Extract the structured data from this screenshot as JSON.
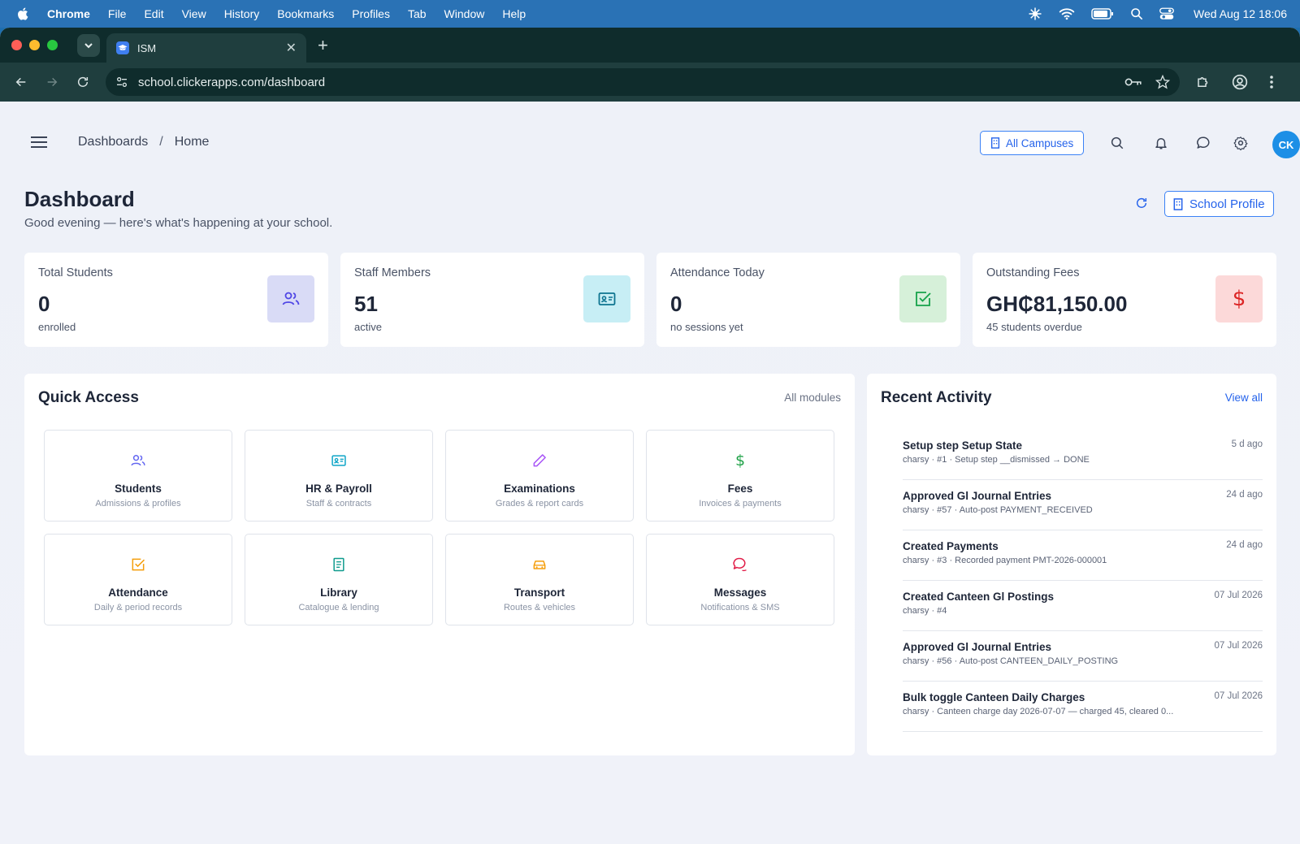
{
  "menubar": {
    "app": "Chrome",
    "items": [
      "File",
      "Edit",
      "View",
      "History",
      "Bookmarks",
      "Profiles",
      "Tab",
      "Window",
      "Help"
    ],
    "clock": "Wed Aug 12  18:06"
  },
  "browser": {
    "tab_title": "ISM",
    "url": "school.clickerapps.com/dashboard"
  },
  "topbar": {
    "breadcrumb": [
      "Dashboards",
      "Home"
    ],
    "campus_button": "All Campuses",
    "avatar_initials": "CK"
  },
  "header": {
    "title": "Dashboard",
    "subtitle": "Good evening — here's what's happening at your school.",
    "profile_button": "School Profile"
  },
  "stats": [
    {
      "label": "Total Students",
      "value": "0",
      "note": "enrolled",
      "icon": "users-icon",
      "color": "#d9dbf6"
    },
    {
      "label": "Staff Members",
      "value": "51",
      "note": "active",
      "icon": "id-card-icon",
      "color": "#c7eef5"
    },
    {
      "label": "Attendance Today",
      "value": "0",
      "note": "no sessions yet",
      "icon": "check-square-icon",
      "color": "#d6f0d9"
    },
    {
      "label": "Outstanding Fees",
      "value": "GH₵81,150.00",
      "note": "45 students overdue",
      "icon": "dollar-icon",
      "color": "#fcd9d9"
    }
  ],
  "quick_access": {
    "title": "Quick Access",
    "link": "All modules",
    "modules": [
      {
        "label": "Students",
        "sub": "Admissions & profiles",
        "icon": "users-icon",
        "color": "#6366f1"
      },
      {
        "label": "HR & Payroll",
        "sub": "Staff & contracts",
        "icon": "id-card-icon",
        "color": "#0ea5c7"
      },
      {
        "label": "Examinations",
        "sub": "Grades & report cards",
        "icon": "pencil-icon",
        "color": "#a855f7"
      },
      {
        "label": "Fees",
        "sub": "Invoices & payments",
        "icon": "dollar-icon",
        "color": "#22a34a"
      },
      {
        "label": "Attendance",
        "sub": "Daily & period records",
        "icon": "check-square-icon",
        "color": "#f59e0b"
      },
      {
        "label": "Library",
        "sub": "Catalogue & lending",
        "icon": "book-icon",
        "color": "#0f9b8e"
      },
      {
        "label": "Transport",
        "sub": "Routes & vehicles",
        "icon": "car-icon",
        "color": "#f59e0b"
      },
      {
        "label": "Messages",
        "sub": "Notifications & SMS",
        "icon": "chat-icon",
        "color": "#e11d48"
      }
    ]
  },
  "recent_activity": {
    "title": "Recent Activity",
    "link": "View all",
    "items": [
      {
        "title": "Setup step Setup State",
        "meta": "charsy · #1 · Setup step __dismissed → DONE",
        "time": "5 d ago"
      },
      {
        "title": "Approved Gl Journal Entries",
        "meta": "charsy · #57 · Auto-post PAYMENT_RECEIVED",
        "time": "24 d ago"
      },
      {
        "title": "Created Payments",
        "meta": "charsy · #3 · Recorded payment PMT-2026-000001",
        "time": "24 d ago"
      },
      {
        "title": "Created Canteen Gl Postings",
        "meta": "charsy · #4",
        "time": "07 Jul 2026"
      },
      {
        "title": "Approved Gl Journal Entries",
        "meta": "charsy · #56 · Auto-post CANTEEN_DAILY_POSTING",
        "time": "07 Jul 2026"
      },
      {
        "title": "Bulk toggle Canteen Daily Charges",
        "meta": "charsy · Canteen charge day 2026-07-07 — charged 45, cleared 0...",
        "time": "07 Jul 2026"
      }
    ]
  }
}
